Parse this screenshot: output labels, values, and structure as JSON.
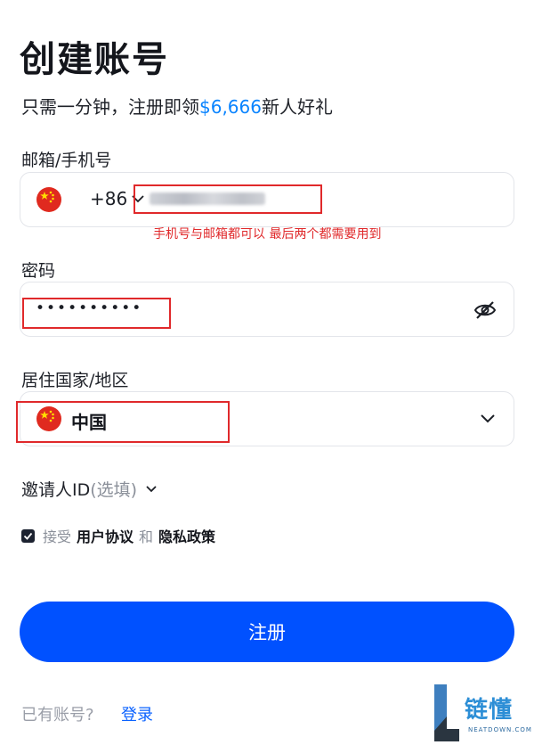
{
  "header": {
    "title": "创建账号",
    "subtitle_prefix": "只需一分钟，注册即领",
    "subtitle_amount": "$6,666",
    "subtitle_suffix": "新人好礼"
  },
  "account": {
    "label": "邮箱/手机号",
    "dial_code": "+86",
    "flag": "china-flag-icon"
  },
  "annotation": "手机号与邮箱都可以 最后两个都需要用到",
  "password": {
    "label": "密码",
    "masked_value": "••••••••••",
    "toggle_icon": "eye-slash-icon"
  },
  "country": {
    "label": "居住国家/地区",
    "selected": "中国"
  },
  "invite": {
    "label": "邀请人ID",
    "optional": "(选填)"
  },
  "agreement": {
    "checked": true,
    "prefix": "接受",
    "user_agreement": "用户协议",
    "conjunction": "和",
    "privacy_policy": "隐私政策"
  },
  "register_button": "注册",
  "footer": {
    "have_account": "已有账号?",
    "login": "登录"
  },
  "watermark": {
    "name": "链懂",
    "domain": "NEATDOWN.COM"
  },
  "colors": {
    "accent": "#0a84ff",
    "button": "#0051ff",
    "annotation_red": "#e0292b"
  }
}
